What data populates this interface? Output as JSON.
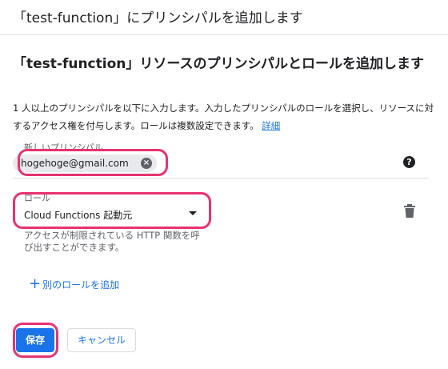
{
  "header": {
    "title": "「test-function」にプリンシパルを追加します"
  },
  "section": {
    "title": "「test-function」リソースのプリンシパルとロールを追加します",
    "description": "1 人以上のプリンシパルを以下に入力します。入力したプリンシパルのロールを選択し、リソースに対するアクセス権を付与します。ロールは複数設定できます。",
    "details_link": "詳細"
  },
  "principal_field": {
    "label": "新しいプリンシパル",
    "chip_value": "hogehoge@gmail.com",
    "help_icon": "help-icon"
  },
  "role_field": {
    "label": "ロール",
    "value": "Cloud Functions 起動元",
    "help_text": "アクセスが制限されている HTTP 関数を呼び出すことができます。",
    "delete_icon": "trash-icon"
  },
  "add_role": {
    "label": "別のロールを追加"
  },
  "actions": {
    "save": "保存",
    "cancel": "キャンセル"
  },
  "colors": {
    "accent": "#1a73e8",
    "highlight": "#e8336f",
    "chip_bg": "#e8eaed"
  }
}
